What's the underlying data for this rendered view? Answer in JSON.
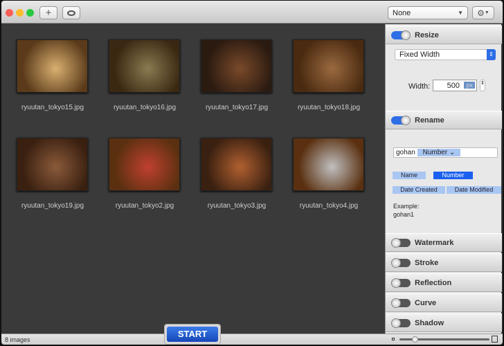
{
  "toolbar": {
    "add_icon": "plus-icon",
    "preview_icon": "eye-icon",
    "preset_select": "None",
    "settings_icon": "gear-icon"
  },
  "images": [
    {
      "name": "ryuutan_tokyo15.jpg",
      "colors": [
        "#5a3a1a",
        "#d9b070"
      ]
    },
    {
      "name": "ryuutan_tokyo16.jpg",
      "colors": [
        "#3a2812",
        "#8a7a50"
      ]
    },
    {
      "name": "ryuutan_tokyo17.jpg",
      "colors": [
        "#2a1a10",
        "#7a4a2a"
      ]
    },
    {
      "name": "ryuutan_tokyo18.jpg",
      "colors": [
        "#4a2a10",
        "#9a6a40"
      ]
    },
    {
      "name": "ryuutan_tokyo19.jpg",
      "colors": [
        "#3a2010",
        "#8a5a3a"
      ]
    },
    {
      "name": "ryuutan_tokyo2.jpg",
      "colors": [
        "#5a3010",
        "#c04030"
      ]
    },
    {
      "name": "ryuutan_tokyo3.jpg",
      "colors": [
        "#3a2010",
        "#b06030"
      ]
    },
    {
      "name": "ryuutan_tokyo4.jpg",
      "colors": [
        "#5a3010",
        "#c0c0c0"
      ]
    }
  ],
  "sidebar": {
    "resize": {
      "title": "Resize",
      "enabled": true,
      "mode": "Fixed Width",
      "width_label": "Width:",
      "width_value": "500",
      "unit": "px"
    },
    "rename": {
      "title": "Rename",
      "enabled": true,
      "prefix": "gohan",
      "token": "Number",
      "tags": [
        "Name",
        "Number",
        "Date Created",
        "Date Modified"
      ],
      "example_label": "Example:",
      "example_value": "gohan1"
    },
    "sections": [
      {
        "title": "Watermark",
        "enabled": false
      },
      {
        "title": "Stroke",
        "enabled": false
      },
      {
        "title": "Reflection",
        "enabled": false
      },
      {
        "title": "Curve",
        "enabled": false
      },
      {
        "title": "Shadow",
        "enabled": false
      }
    ]
  },
  "status": {
    "count": "8 images",
    "start_label": "START",
    "zoom_level": 0.15
  },
  "colors": {
    "accent": "#2e6ee6",
    "tag": "#a9c6f2"
  }
}
